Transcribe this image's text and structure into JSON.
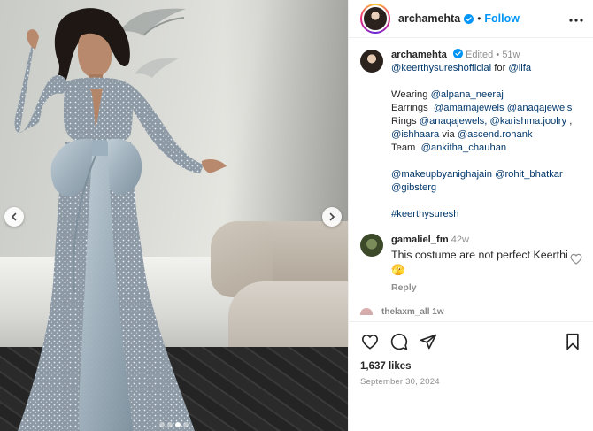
{
  "post": {
    "photo": {
      "slide_count": 4,
      "active_slide": 3
    },
    "author": {
      "username": "archamehta",
      "follow_label": "Follow",
      "separator": "•"
    },
    "caption": {
      "username": "archamehta",
      "edited": "Edited",
      "dot": "•",
      "age": "51w",
      "line1_mention": "@keerthysureshofficial",
      "line1_for": "for",
      "line1_mention2": "@iifa",
      "wearing_label": "Wearing",
      "wearing_mention": "@alpana_neeraj",
      "earrings_label": "Earrings",
      "earrings_m1": "@amamajewels",
      "earrings_m2": "@anaqajewels",
      "rings_label": "Rings",
      "rings_m1": "@anaqajewels,",
      "rings_m2": "@karishma.joolry",
      "rings_comma": ",",
      "ishhaara": "@ishhaara",
      "via": "via",
      "ascend": "@ascend.rohank",
      "team_label": "Team",
      "team_mention": "@ankitha_chauhan",
      "mua1": "@makeupbyanighajain",
      "mua2": "@rohit_bhatkar",
      "mua3": "@gibsterg",
      "hashtag": "#keerthysuresh"
    },
    "comment": {
      "username": "gamaliel_fm",
      "age": "42w",
      "text": "This costume are not perfect Keerthi 🫣",
      "reply_label": "Reply"
    },
    "peek_comment": {
      "username": "thelaxm_all  1w"
    },
    "likes": "1,637 likes",
    "date": "September 30, 2024"
  },
  "icons": {
    "prev": "chevron-left-icon",
    "next": "chevron-right-icon",
    "more": "more-icon",
    "like": "heart-icon",
    "comment": "comment-icon",
    "share": "share-icon",
    "save": "bookmark-icon",
    "verified": "verified-badge-icon"
  },
  "colors": {
    "link": "#00376b",
    "follow": "#0095f6",
    "muted": "#8e8e8e",
    "verified": "#0095f6"
  }
}
